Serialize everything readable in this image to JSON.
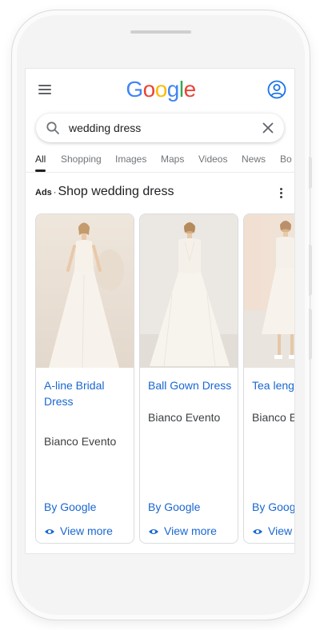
{
  "header": {
    "logo_letters": [
      {
        "ch": "G",
        "color": "#4285F4"
      },
      {
        "ch": "o",
        "color": "#EA4335"
      },
      {
        "ch": "o",
        "color": "#FBBC05"
      },
      {
        "ch": "g",
        "color": "#4285F4"
      },
      {
        "ch": "l",
        "color": "#34A853"
      },
      {
        "ch": "e",
        "color": "#EA4335"
      }
    ]
  },
  "search": {
    "query": "wedding dress"
  },
  "tabs": [
    {
      "label": "All",
      "active": true
    },
    {
      "label": "Shopping",
      "active": false
    },
    {
      "label": "Images",
      "active": false
    },
    {
      "label": "Maps",
      "active": false
    },
    {
      "label": "Videos",
      "active": false
    },
    {
      "label": "News",
      "active": false
    },
    {
      "label": "Bo",
      "active": false
    }
  ],
  "ads": {
    "label": "Ads",
    "separator": "·",
    "title": "Shop wedding dress"
  },
  "products": [
    {
      "title": "A-line Bridal Dress",
      "seller": "Bianco Evento",
      "by": "By Google",
      "view_more": "View more"
    },
    {
      "title": "Ball Gown Dress",
      "seller": "Bianco Evento",
      "by": "By Google",
      "view_more": "View more"
    },
    {
      "title": "Tea lenghth",
      "title_visible": "Tea lengh",
      "seller": "Bianco Ev",
      "by": "By Goog",
      "view_more": "View r"
    }
  ],
  "colors": {
    "link": "#1967d2",
    "text": "#202124",
    "muted": "#70757a"
  }
}
